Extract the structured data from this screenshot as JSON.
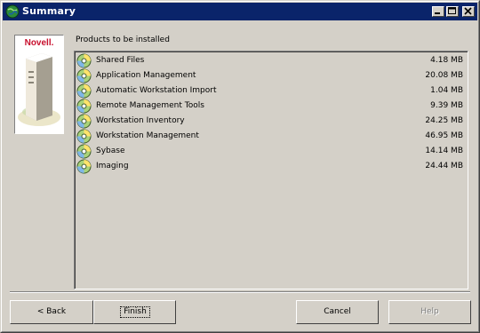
{
  "window": {
    "title": "Summary"
  },
  "logo": {
    "brand": "Novell."
  },
  "heading": "Products to be installed",
  "products": [
    {
      "name": "Shared Files",
      "size": "4.18 MB"
    },
    {
      "name": "Application Management",
      "size": "20.08 MB"
    },
    {
      "name": "Automatic Workstation Import",
      "size": "1.04 MB"
    },
    {
      "name": "Remote Management Tools",
      "size": "9.39 MB"
    },
    {
      "name": "Workstation Inventory",
      "size": "24.25 MB"
    },
    {
      "name": "Workstation Management",
      "size": "46.95 MB"
    },
    {
      "name": "Sybase",
      "size": "14.14 MB"
    },
    {
      "name": "Imaging",
      "size": "24.44 MB"
    }
  ],
  "buttons": {
    "back": "< Back",
    "finish": "Finish",
    "cancel": "Cancel",
    "help": "Help"
  },
  "colors": {
    "titlebar": "#0a246a",
    "face": "#d4d0c8",
    "brand_red": "#c8102e"
  },
  "icons": {
    "title": "globe-icon",
    "product": "cd-disc-icon"
  }
}
